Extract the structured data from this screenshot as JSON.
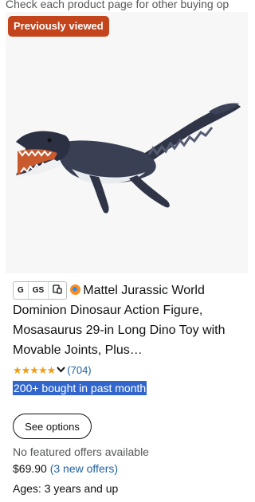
{
  "top_note": "Check each product page for other buying op",
  "badge": "Previously viewed",
  "product": {
    "image_icon": "mosasaurus-toy-image",
    "pills": [
      "G",
      "GS",
      "device-icon"
    ],
    "store_icon": "store-logo-icon",
    "title": "Mattel Jurassic World Dominion Dinosaur Action Figure, Mosasaurus 29-in Long Dino Toy with Movable Joints, Plus…",
    "rating_stars": "★★★★★",
    "rating_count": "(704)",
    "bought": "200+ bought in past month",
    "see_options_label": "See options",
    "no_offers": "No featured offers available",
    "price": "$69.90",
    "offers_link": "(3 new offers)",
    "ages": "Ages: 3 years and up"
  },
  "colors": {
    "badge": "#c4451c",
    "link": "#2162a1",
    "star": "#f39c12",
    "highlight": "#3366cc"
  }
}
